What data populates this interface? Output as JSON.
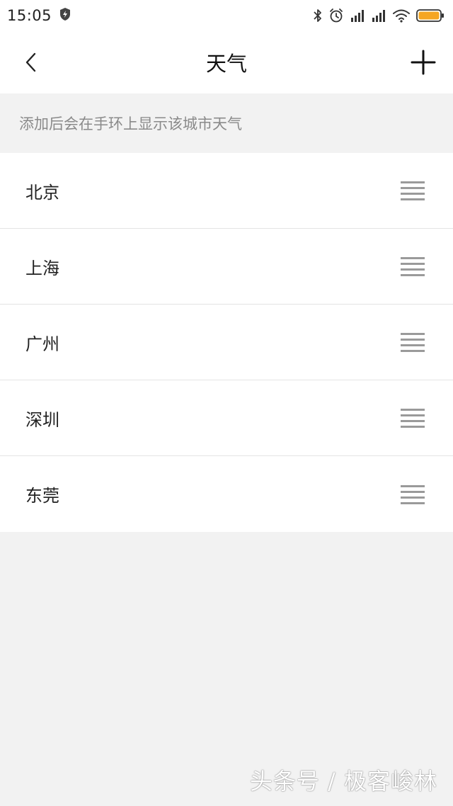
{
  "status_bar": {
    "time": "15:05",
    "icons": [
      "shield-icon",
      "bluetooth-icon",
      "alarm-icon",
      "signal-icon",
      "signal-icon",
      "wifi-icon",
      "battery-icon"
    ],
    "battery_color": "#f5a623"
  },
  "header": {
    "title": "天气",
    "back_icon": "chevron-left-icon",
    "add_icon": "plus-icon"
  },
  "hint": {
    "text": "添加后会在手环上显示该城市天气"
  },
  "cities": [
    {
      "name": "北京"
    },
    {
      "name": "上海"
    },
    {
      "name": "广州"
    },
    {
      "name": "深圳"
    },
    {
      "name": "东莞"
    }
  ],
  "watermark": {
    "text": "头条号 / 极客峻林"
  },
  "colors": {
    "background": "#f2f2f2",
    "surface": "#ffffff",
    "hint_text": "#8a8a8a",
    "handle": "#9a9a9a"
  }
}
